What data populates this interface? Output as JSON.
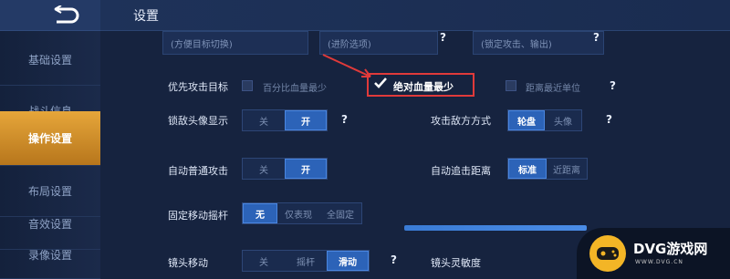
{
  "header": {
    "title": "设置"
  },
  "sidebar": {
    "items": [
      {
        "label": "基础设置"
      },
      {
        "label": "战斗信息"
      },
      {
        "label": "操作设置"
      },
      {
        "label": "布局设置"
      },
      {
        "label": "音效设置"
      },
      {
        "label": "录像设置"
      }
    ],
    "active_index": 2
  },
  "top_fields": {
    "left": "(方便目标切换)",
    "middle": "(进阶选项)",
    "right": "(锁定攻击、输出)"
  },
  "priority_target": {
    "label": "优先攻击目标",
    "option1": "百分比血量最少",
    "option2": "绝对血量最少",
    "option3": "距离最近单位",
    "selected": "绝对血量最少"
  },
  "enemy_avatar": {
    "label": "锁敌头像显示",
    "off": "关",
    "on": "开",
    "selected": "开"
  },
  "attack_method": {
    "label": "攻击敌方方式",
    "option1": "轮盘",
    "option2": "头像",
    "selected": "轮盘"
  },
  "auto_attack": {
    "label": "自动普通攻击",
    "off": "关",
    "on": "开",
    "selected": "开"
  },
  "auto_chase": {
    "label": "自动追击距离",
    "option1": "标准",
    "option2": "近距离",
    "selected": "标准"
  },
  "fixed_joystick": {
    "label": "固定移动摇杆",
    "option1": "无",
    "option2": "仅表现",
    "option3": "全固定",
    "selected": "无"
  },
  "camera_move": {
    "label": "镜头移动",
    "option1": "关",
    "option2": "摇杆",
    "option3": "滑动",
    "selected": "滑动"
  },
  "camera_sensitivity": {
    "label": "镜头灵敏度"
  },
  "help_symbol": "?",
  "watermark": {
    "brand": "DVG游戏网",
    "url": "WWW.DVG.CN"
  },
  "colors": {
    "accent_active": "#e6a63a",
    "toggle_on": "#2c63b8",
    "highlight_box": "#e03a3a"
  }
}
